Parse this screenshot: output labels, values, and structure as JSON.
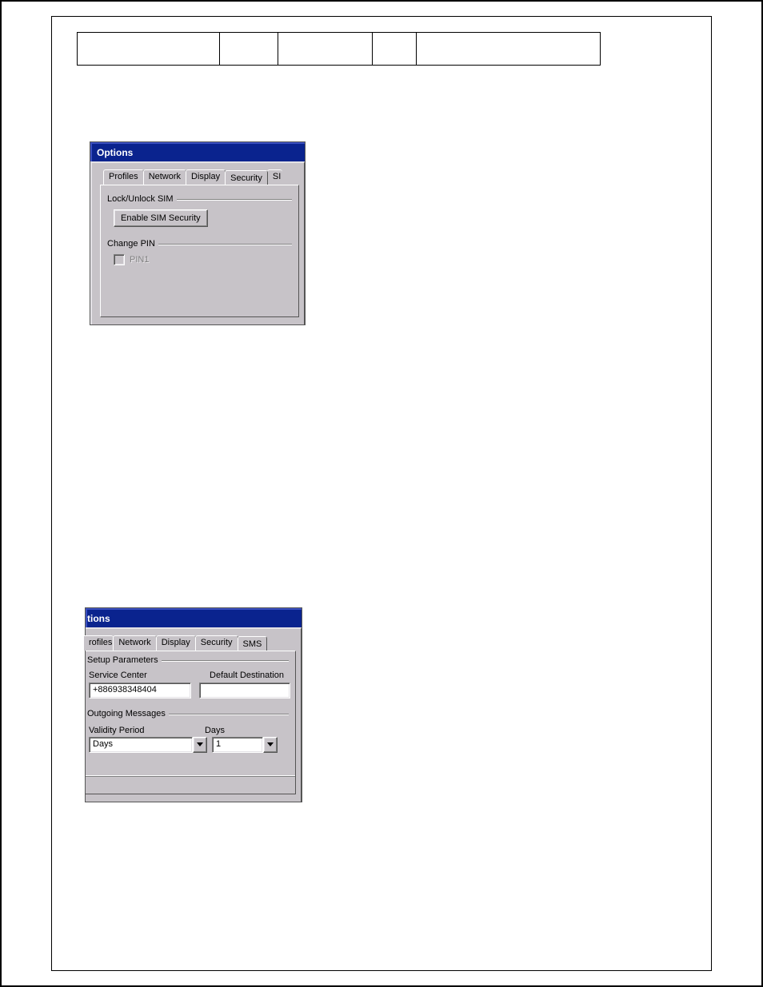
{
  "window1": {
    "title": "Options",
    "tabs": {
      "profiles": "Profiles",
      "network": "Network",
      "display": "Display",
      "security": "Security",
      "partial": "SI"
    },
    "group_lock_label": "Lock/Unlock SIM",
    "enable_sim_button": "Enable SIM Security",
    "group_pin_label": "Change PIN",
    "pin1_label": "PIN1"
  },
  "window2": {
    "title_fragment": "tions",
    "tabs": {
      "profiles_fragment": "rofiles",
      "network": "Network",
      "display": "Display",
      "security": "Security",
      "sms": "SMS"
    },
    "group_setup_label": "Setup Parameters",
    "service_center_label": "Service Center",
    "default_dest_label": "Default Destination",
    "service_center_value": "+886938348404",
    "default_dest_value": "",
    "group_outgoing_label": "Outgoing Messages",
    "validity_period_label": "Validity Period",
    "days_label": "Days",
    "validity_value": "Days",
    "days_value": "1"
  }
}
